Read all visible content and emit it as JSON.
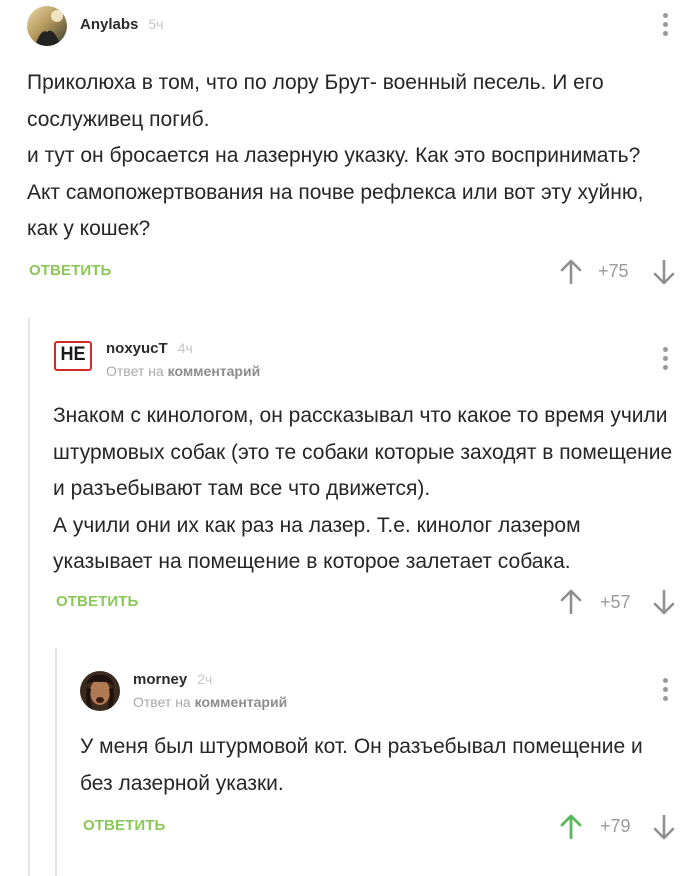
{
  "comments": [
    {
      "author": "Anylabs",
      "time": "5ч",
      "text": [
        "Приколюха в том, что по лору Брут- военный песель. И его сослуживец погиб.",
        "и тут он бросается на лазерную указку. Как это воспринимать? Акт самопожертвования на почве рефлекса или вот эту хуйню, как у кошек?"
      ],
      "reply_label": "ОТВЕТИТЬ",
      "rating": "+75"
    },
    {
      "author": "noxyucT",
      "time": "4ч",
      "avatar_text": "НЕ",
      "reply_to_prefix": "Ответ на",
      "reply_to_target": "комментарий",
      "text": [
        "Знаком с кинологом, он рассказывал что какое то время учили штурмовых собак (это те собаки которые заходят в помещение и разъебывают там все что движется).",
        "А учили они их как раз на лазер. Т.е. кинолог лазером указывает на помещение в которое залетает собака."
      ],
      "reply_label": "ОТВЕТИТЬ",
      "rating": "+57"
    },
    {
      "author": "morney",
      "time": "2ч",
      "reply_to_prefix": "Ответ на",
      "reply_to_target": "комментарий",
      "text": [
        "У меня был штурмовой кот. Он разъебывал помещение и без лазерной указки."
      ],
      "reply_label": "ОТВЕТИТЬ",
      "rating": "+79",
      "upvoted": true
    }
  ],
  "colors": {
    "accent_green": "#8ac858",
    "upvoted_green": "#5cb85c",
    "meta_gray": "#a8a8a8",
    "logo_red": "#d52a2a"
  },
  "icons": [
    "more-vertical-icon",
    "arrow-up-icon",
    "arrow-down-icon"
  ]
}
